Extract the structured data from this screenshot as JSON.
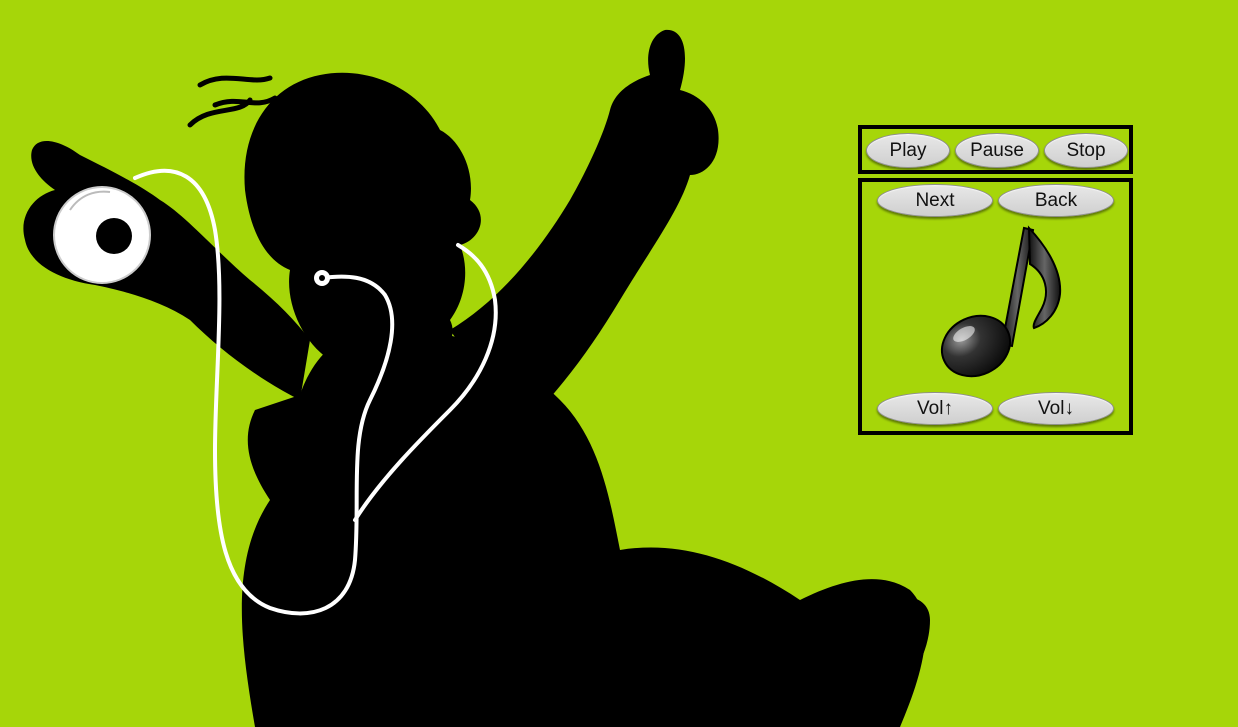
{
  "background": {
    "color": "#a6d609",
    "art": "dancing-silhouette-with-music-player"
  },
  "player": {
    "transport": {
      "play": "Play",
      "pause": "Pause",
      "stop": "Stop"
    },
    "navigation": {
      "next": "Next",
      "back": "Back"
    },
    "volume": {
      "up": "Vol↑",
      "down": "Vol↓"
    },
    "icon": "music-note-icon"
  }
}
